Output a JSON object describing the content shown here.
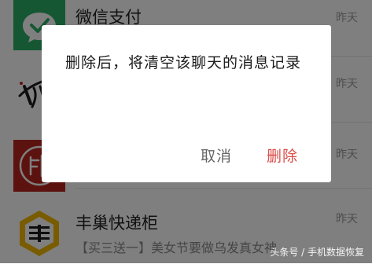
{
  "chats": [
    {
      "name": "微信支付",
      "preview": "",
      "time": "昨天",
      "avatar_icon": "wechat-pay-icon"
    },
    {
      "name": "",
      "preview": "",
      "time": "昨天",
      "avatar_icon": "calligraphy-logo-icon"
    },
    {
      "name": "",
      "preview": "",
      "time": "昨天",
      "avatar_icon": "red-seal-icon"
    },
    {
      "name": "丰巢快递柜",
      "preview": "【买三送一】美女节要做乌发真女神",
      "time": "昨天",
      "avatar_icon": "hive-box-icon"
    }
  ],
  "dialog": {
    "message": "删除后，将清空该聊天的消息记录",
    "cancel_label": "取消",
    "delete_label": "删除"
  },
  "watermark": "头条号 / 手机数据恢复",
  "colors": {
    "wechat_green": "#2aae67",
    "delete_red": "#d94a45",
    "hive_yellow": "#f5b800",
    "seal_red": "#b8261e"
  }
}
